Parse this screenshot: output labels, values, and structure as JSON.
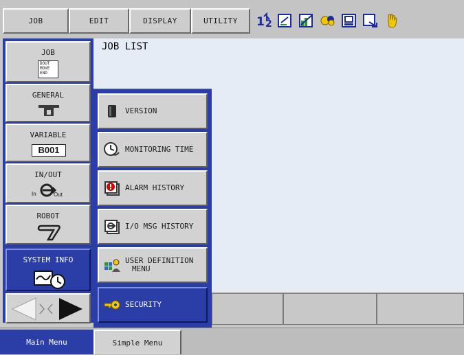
{
  "top_menu": {
    "job": "JOB",
    "edit": "EDIT",
    "display": "DISPLAY",
    "utility": "UTILITY"
  },
  "status_icons": [
    "step-number-icon",
    "edit-mode-icon",
    "graph-icon",
    "link-icon",
    "monitor-icon",
    "output-icon",
    "hand-icon"
  ],
  "content": {
    "title": "JOB LIST"
  },
  "main_menu": {
    "items": [
      {
        "label": "JOB",
        "icon": "job-document-icon",
        "icon_text": [
          "DOUT",
          "MOVE",
          "END"
        ]
      },
      {
        "label": "GENERAL",
        "icon": "tool-icon"
      },
      {
        "label": "VARIABLE",
        "icon": "variable-icon",
        "icon_text": "B001"
      },
      {
        "label": "IN/OUT",
        "icon": "in-out-icon",
        "icon_in": "In",
        "icon_out": "Out"
      },
      {
        "label": "ROBOT",
        "icon": "robot-arm-icon"
      },
      {
        "label": "SYSTEM INFO",
        "icon": "system-info-icon",
        "active": true
      }
    ]
  },
  "submenu": {
    "items": [
      {
        "label": "VERSION",
        "icon": "version-icon"
      },
      {
        "label": "MONITORING TIME",
        "icon": "monitoring-time-icon"
      },
      {
        "label": "ALARM HISTORY",
        "icon": "alarm-history-icon"
      },
      {
        "label": "I/O MSG HISTORY",
        "icon": "io-msg-history-icon"
      },
      {
        "label_line1": "USER DEFINITION",
        "label_line2": "MENU",
        "icon": "user-definition-icon"
      },
      {
        "label": "SECURITY",
        "icon": "key-icon",
        "active": true
      }
    ]
  },
  "bottom_tabs": {
    "main": "Main Menu",
    "simple": "Simple Menu"
  },
  "colors": {
    "accent": "#2b3ea8",
    "panel": "#d2d2d2",
    "content_bg": "#e6ecf6"
  }
}
